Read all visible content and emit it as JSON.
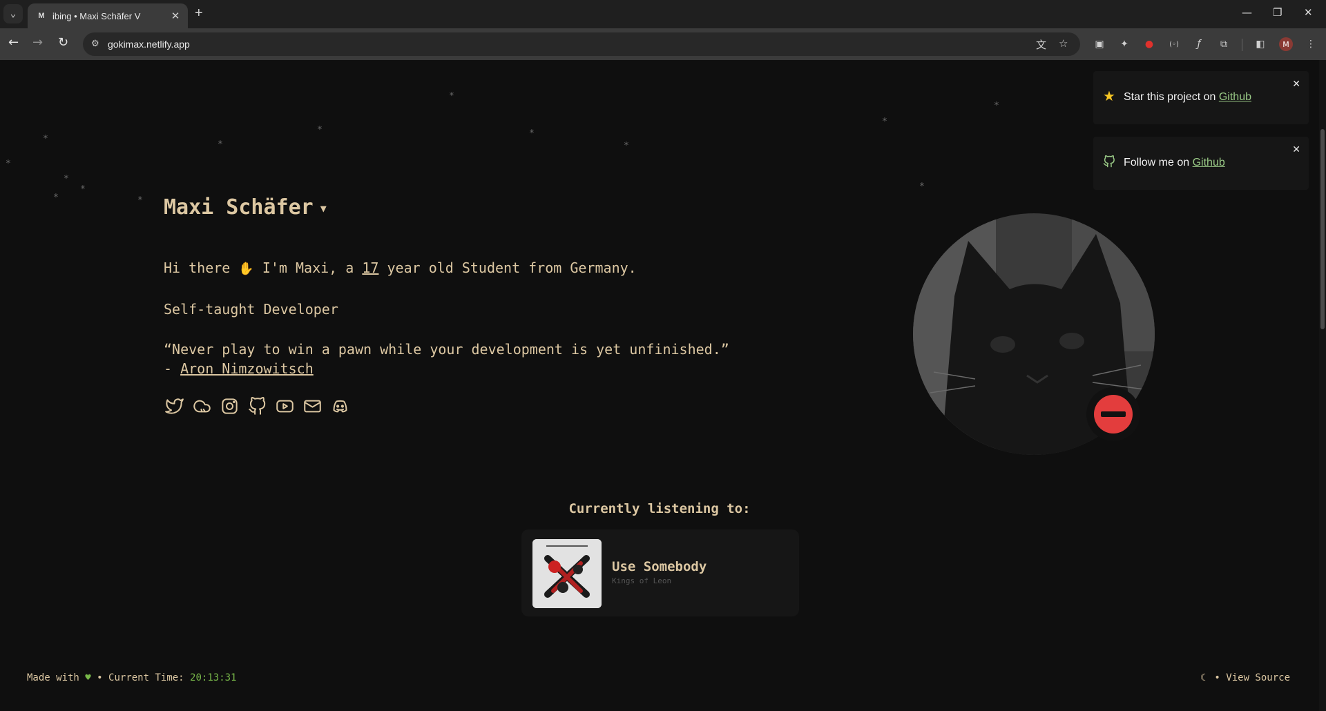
{
  "browser": {
    "tab_title": "ibing • Maxi Schäfer V",
    "tab_favicon": "M",
    "url": "gokimax.netlify.app",
    "profile_initial": "M"
  },
  "profile": {
    "name": "Maxi Schäfer",
    "greeting_pre": "Hi there",
    "greeting_mid": "I'm Maxi, a",
    "age": "17",
    "greeting_post": "year old Student from Germany.",
    "role": "Self-taught Developer",
    "quote": "“Never play to win a pawn while your development is yet unfinished.”",
    "quote_prefix": "- ",
    "quote_author": "Aron Nimzowitsch"
  },
  "socials": [
    "twitter-icon",
    "cloud-icon",
    "instagram-icon",
    "github-icon",
    "youtube-icon",
    "mail-icon",
    "discord-icon"
  ],
  "avatar": {
    "status": "do-not-disturb",
    "status_color": "#e33d3d"
  },
  "toasts": [
    {
      "text": "Star this project on ",
      "link": "Github",
      "icon": "star-icon"
    },
    {
      "text": "Follow me on ",
      "link": "Github",
      "icon": "github-icon"
    }
  ],
  "now_playing": {
    "heading": "Currently listening to:",
    "title": "Use Somebody",
    "artist": "Kings of Leon"
  },
  "footer": {
    "made_with": "Made with",
    "current_time_label": "• Current Time:",
    "time": "20:13:31",
    "separator": "•",
    "view_source": "View Source"
  },
  "colors": {
    "accent": "#dcc7a2",
    "background": "#0f0f0f",
    "link_green": "#99c986",
    "time_green": "#79b94a"
  }
}
